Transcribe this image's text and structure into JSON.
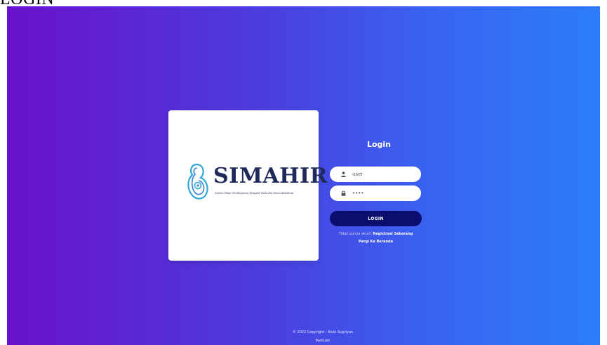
{
  "page": {
    "heading": "LOGIN"
  },
  "brand": {
    "name": "SIMAHIR",
    "tagline": "Sistem Pakar Pendiagnosa Penyakit Pada Ibu Pasca Kelahiran",
    "logo_icon": "pregnancy-logo-icon",
    "colors": {
      "mark": "#2fa9d6",
      "text": "#1f2a5a"
    }
  },
  "login": {
    "title": "Login",
    "username_value": "user",
    "username_icon": "user-icon",
    "password_value": "••••",
    "password_icon": "lock-icon",
    "button_label": "LOGIN",
    "register_prompt": "Tidak punya akun?",
    "register_link": "Registrasi Sekarang",
    "home_link": "Pergi Ke Beranda",
    "colors": {
      "button": "#0a0f6e",
      "gradient_start": "#6a11cb",
      "gradient_end": "#2b7dfb"
    }
  },
  "footer": {
    "copyright": "© 2022 Copyright : Alvin Supriyan",
    "help_link": "Bantuan"
  }
}
